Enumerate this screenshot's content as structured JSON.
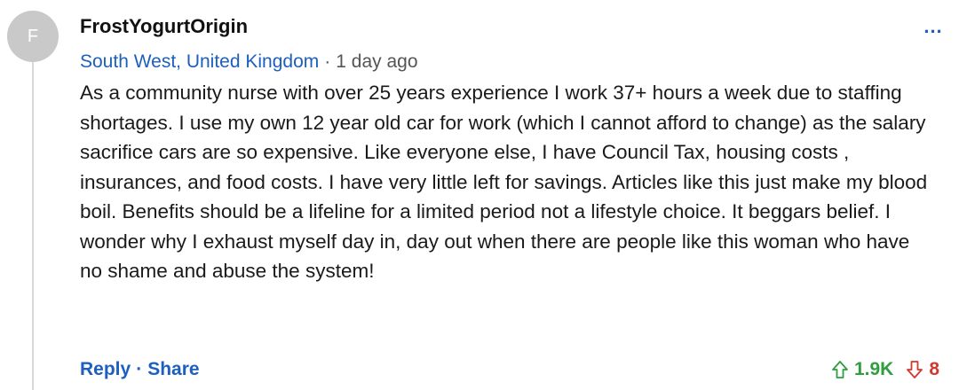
{
  "comment": {
    "avatar_initial": "F",
    "username": "FrostYogurtOrigin",
    "location": "South West, United Kingdom",
    "separator": "·",
    "time_ago": "1 day ago",
    "text": "As a community nurse with over 25 years experience I work 37+ hours a week due to staffing shortages. I use my own 12 year old car for work (which I cannot afford to change) as the salary sacrifice cars are so expensive. Like everyone else, I have Council Tax, housing costs , insurances, and food costs. I have very little left for savings. Articles like this just make my blood boil. Benefits should be a lifeline for a limited period not a lifestyle choice. It beggars belief. I wonder why I exhaust myself day in, day out when there are people like this woman who have no shame and abuse the system!",
    "more_label": "...",
    "more_icon": "ellipsis-icon"
  },
  "actions": {
    "reply_label": "Reply",
    "separator": "·",
    "share_label": "Share"
  },
  "votes": {
    "up_icon": "arrow-up-icon",
    "up_count": "1.9K",
    "down_icon": "arrow-down-icon",
    "down_count": "8"
  },
  "colors": {
    "link": "#1d5fbf",
    "upvote": "#2e9e3e",
    "downvote": "#d03a2f",
    "avatar_bg": "#c9c9c9"
  }
}
